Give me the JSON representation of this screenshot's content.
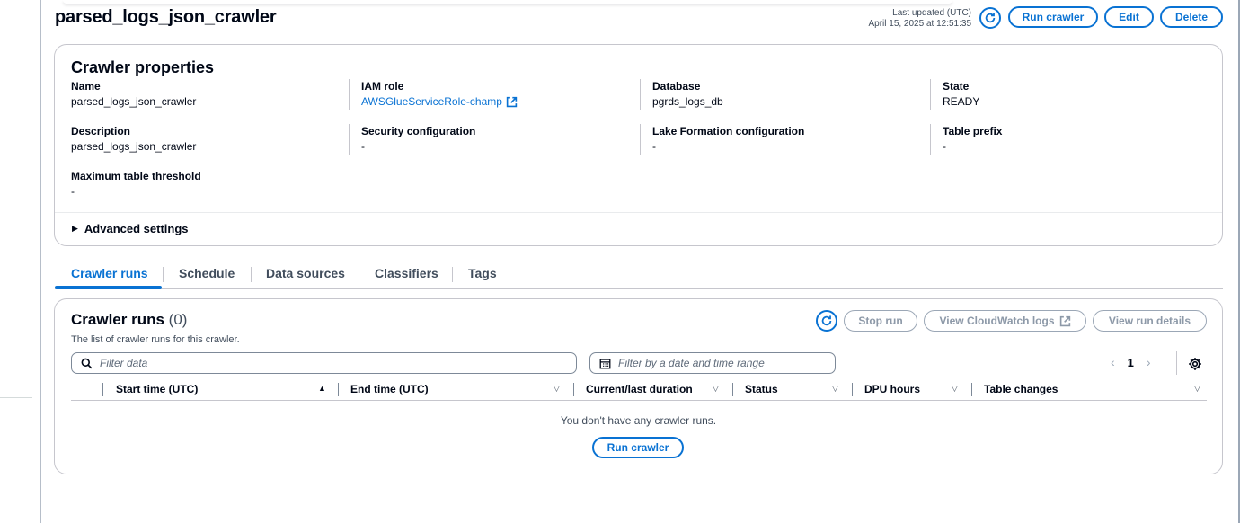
{
  "header": {
    "title": "parsed_logs_json_crawler",
    "last_updated_label": "Last updated (UTC)",
    "last_updated_value": "April 15, 2025 at 12:51:35",
    "buttons": {
      "run": "Run crawler",
      "edit": "Edit",
      "delete": "Delete"
    },
    "refresh_icon": "refresh-icon"
  },
  "properties": {
    "title": "Crawler properties",
    "items": [
      {
        "label": "Name",
        "value": "parsed_logs_json_crawler"
      },
      {
        "label": "IAM role",
        "value": "AWSGlueServiceRole-champ",
        "icon": "external-link-icon"
      },
      {
        "label": "Database",
        "value": "pgrds_logs_db"
      },
      {
        "label": "State",
        "value": "READY"
      },
      {
        "label": "Description",
        "value": "parsed_logs_json_crawler"
      },
      {
        "label": "Security configuration",
        "value": "-"
      },
      {
        "label": "Lake Formation configuration",
        "value": "-"
      },
      {
        "label": "Table prefix",
        "value": "-"
      },
      {
        "label": "Maximum table threshold",
        "value": "-"
      }
    ],
    "advanced": "Advanced settings"
  },
  "tabs": [
    "Crawler runs",
    "Schedule",
    "Data sources",
    "Classifiers",
    "Tags"
  ],
  "active_tab": "Crawler runs",
  "runs": {
    "title": "Crawler runs",
    "count": "(0)",
    "description": "The list of crawler runs for this crawler.",
    "buttons": {
      "stop": "Stop run",
      "cloudwatch": "View CloudWatch logs",
      "details": "View run details"
    },
    "filter_placeholder": "Filter data",
    "date_placeholder": "Filter by a date and time range",
    "page": "1",
    "pager": {
      "prev": "‹",
      "next": "›"
    },
    "columns": [
      "Start time (UTC)",
      "End time (UTC)",
      "Current/last duration",
      "Status",
      "DPU hours",
      "Table changes"
    ],
    "sort_icons": {
      "asc": "▲",
      "desc": "▽"
    },
    "empty_message": "You don't have any crawler runs.",
    "empty_button": "Run crawler"
  },
  "colors": {
    "accent": "#0972d3",
    "text": "#000716",
    "border": "#c6c6cd"
  }
}
